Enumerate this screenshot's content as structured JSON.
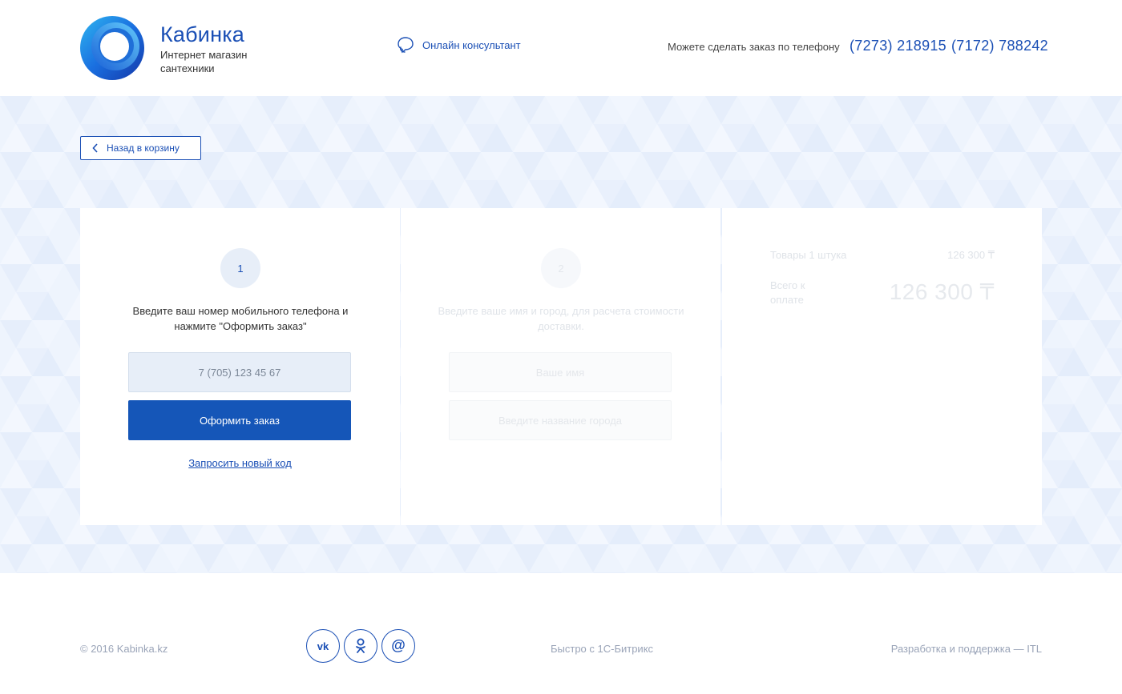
{
  "header": {
    "brand_name": "Кабинка",
    "brand_tagline": "Интернет магазин сантехники",
    "consult_label": "Онлайн консультант",
    "phone_label": "Можете сделать заказ по телефону",
    "phones": [
      "(7273) 218915",
      "(7172) 788242"
    ]
  },
  "nav": {
    "back_label": "Назад в корзину"
  },
  "step1": {
    "number": "1",
    "instruction": "Введите ваш номер мобильного телефона и нажмите \"Оформить заказ\"",
    "phone_placeholder": "7 (705) 123 45 67",
    "submit_label": "Оформить заказ",
    "resend_label": "Запросить новый код"
  },
  "step2": {
    "number": "2",
    "instruction": "Введите ваше имя и город, для расчета стоимости доставки.",
    "name_placeholder": "Ваше имя",
    "city_placeholder": "Введите название города"
  },
  "summary": {
    "items_label": "Товары 1 штука",
    "items_value": "126 300 ₸",
    "total_label": "Всего к оплате",
    "total_value": "126 300 ₸"
  },
  "footer": {
    "copyright": "© 2016 Kabinka.kz",
    "bitrix": "Быстро с 1С-Битрикс",
    "developer": "Разработка и поддержка — ITL",
    "socials": [
      "vk-icon",
      "odnoklassniki-icon",
      "mail-ru-icon"
    ]
  },
  "colors": {
    "accent": "#1a4fb5",
    "button": "#1556b8",
    "band": "#eef4fd"
  }
}
